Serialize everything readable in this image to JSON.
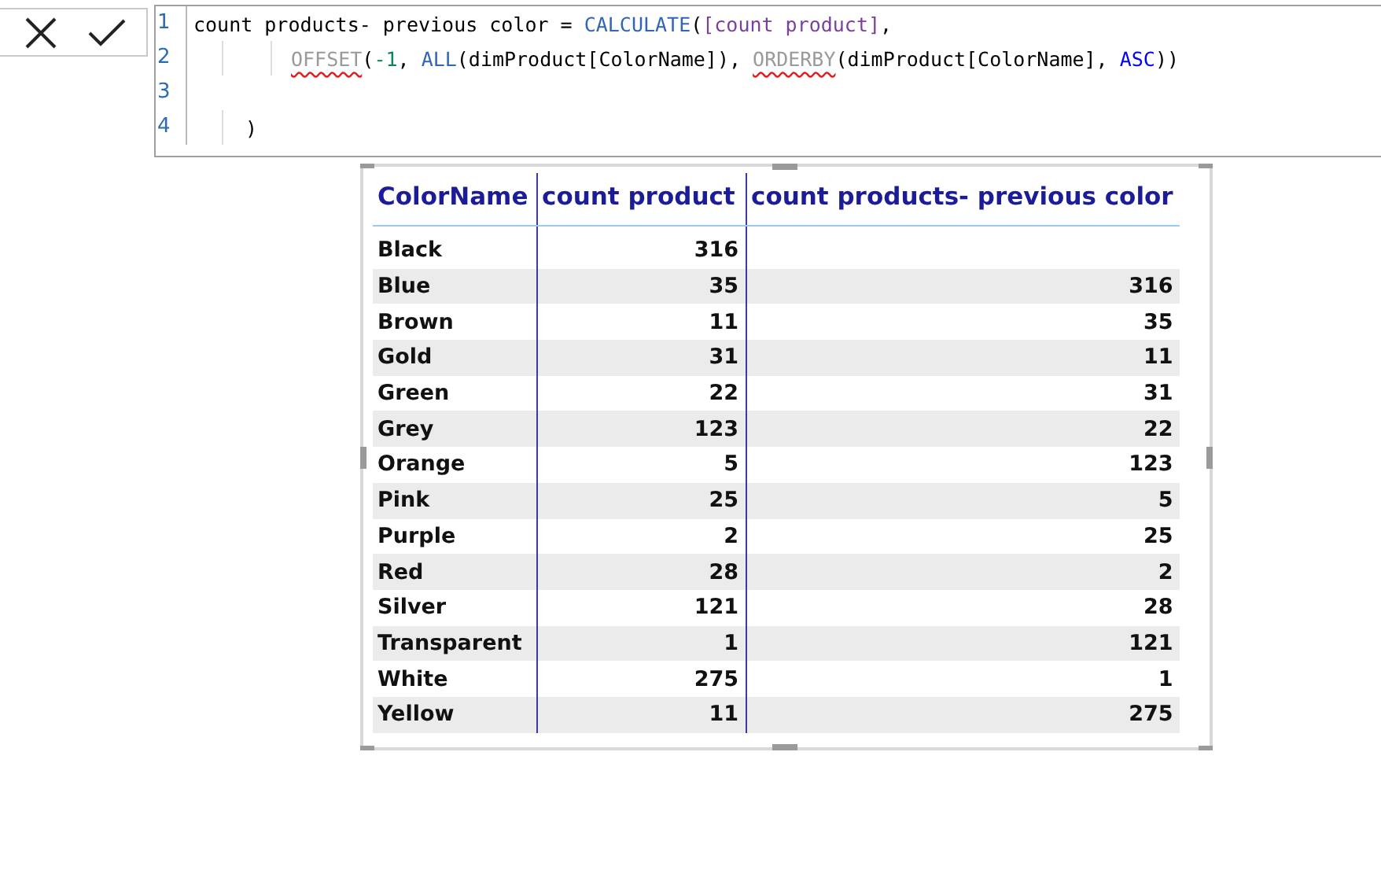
{
  "formula_bar": {
    "code_lines": [
      {
        "number": "1",
        "kind": "statement",
        "tokens": [
          {
            "kind": "plain",
            "text": "count products- previous color = "
          },
          {
            "kind": "function",
            "text": "CALCULATE"
          },
          {
            "kind": "plain",
            "text": "("
          },
          {
            "kind": "measure",
            "text": "[count product]"
          },
          {
            "kind": "plain",
            "text": ","
          }
        ]
      },
      {
        "number": "2",
        "kind": "nested",
        "tokens": [
          {
            "kind": "unknown",
            "text": "OFFSET"
          },
          {
            "kind": "plain",
            "text": "("
          },
          {
            "kind": "number",
            "text": "-1"
          },
          {
            "kind": "plain",
            "text": ", "
          },
          {
            "kind": "function",
            "text": "ALL"
          },
          {
            "kind": "plain",
            "text": "(dimProduct[ColorName]), "
          },
          {
            "kind": "unknown",
            "text": "ORDERBY"
          },
          {
            "kind": "plain",
            "text": "(dimProduct[ColorName], "
          },
          {
            "kind": "keyword",
            "text": "ASC"
          },
          {
            "kind": "plain",
            "text": "))"
          }
        ]
      },
      {
        "number": "3",
        "kind": "blank"
      },
      {
        "number": "4",
        "kind": "closing",
        "tokens": [
          {
            "kind": "plain",
            "text": ")"
          }
        ]
      }
    ]
  },
  "table": {
    "columns": [
      "ColorName",
      "count product",
      "count products- previous color"
    ],
    "rows": [
      {
        "color_name": "Black",
        "count_product": "316"
      },
      {
        "color_name": "Blue",
        "count_product": "35",
        "previous_color_count": "316"
      },
      {
        "color_name": "Brown",
        "count_product": "11",
        "previous_color_count": "35"
      },
      {
        "color_name": "Gold",
        "count_product": "31",
        "previous_color_count": "11"
      },
      {
        "color_name": "Green",
        "count_product": "22",
        "previous_color_count": "31"
      },
      {
        "color_name": "Grey",
        "count_product": "123",
        "previous_color_count": "22"
      },
      {
        "color_name": "Orange",
        "count_product": "5",
        "previous_color_count": "123"
      },
      {
        "color_name": "Pink",
        "count_product": "25",
        "previous_color_count": "5"
      },
      {
        "color_name": "Purple",
        "count_product": "2",
        "previous_color_count": "25"
      },
      {
        "color_name": "Red",
        "count_product": "28",
        "previous_color_count": "2"
      },
      {
        "color_name": "Silver",
        "count_product": "121",
        "previous_color_count": "28"
      },
      {
        "color_name": "Transparent",
        "count_product": "1",
        "previous_color_count": "121"
      },
      {
        "color_name": "White",
        "count_product": "275",
        "previous_color_count": "1"
      },
      {
        "color_name": "Yellow",
        "count_product": "11",
        "previous_color_count": "275"
      }
    ]
  }
}
